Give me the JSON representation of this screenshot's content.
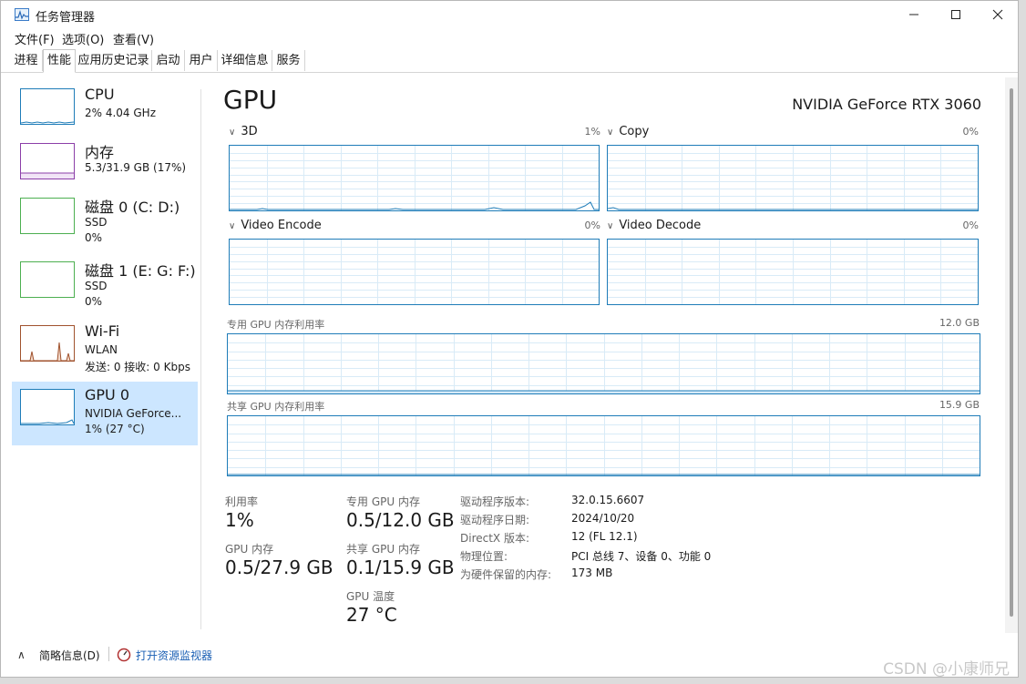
{
  "window": {
    "title": "任务管理器"
  },
  "menu": {
    "items": [
      "文件(F)",
      "选项(O)",
      "查看(V)"
    ]
  },
  "tabs": [
    "进程",
    "性能",
    "应用历史记录",
    "启动",
    "用户",
    "详细信息",
    "服务"
  ],
  "active_tab_index": 1,
  "sidebar": {
    "items": [
      {
        "name": "CPU",
        "line1": "2% 4.04 GHz",
        "line2": "",
        "color": "#1e7cb8"
      },
      {
        "name": "内存",
        "line1": "5.3/31.9 GB (17%)",
        "line2": "",
        "color": "#8b3ea8"
      },
      {
        "name": "磁盘 0 (C: D:)",
        "line1": "SSD",
        "line2": "0%",
        "color": "#4caf50"
      },
      {
        "name": "磁盘 1 (E: G: F:)",
        "line1": "SSD",
        "line2": "0%",
        "color": "#4caf50"
      },
      {
        "name": "Wi-Fi",
        "line1": "WLAN",
        "line2": "发送: 0 接收: 0 Kbps",
        "color": "#a0522d"
      },
      {
        "name": "GPU 0",
        "line1": "NVIDIA GeForce...",
        "line2": "1% (27 °C)",
        "color": "#1e7cb8"
      }
    ],
    "active_index": 5
  },
  "main": {
    "title": "GPU",
    "model": "NVIDIA GeForce RTX 3060",
    "engines": [
      {
        "label": "3D",
        "pct": "1%"
      },
      {
        "label": "Copy",
        "pct": "0%"
      },
      {
        "label": "Video Encode",
        "pct": "0%"
      },
      {
        "label": "Video Decode",
        "pct": "0%"
      }
    ],
    "dedicated_mem_label": "专用 GPU 内存利用率",
    "dedicated_mem_max": "12.0 GB",
    "shared_mem_label": "共享 GPU 内存利用率",
    "shared_mem_max": "15.9 GB"
  },
  "stats": {
    "utilization_label": "利用率",
    "utilization_value": "1%",
    "gpu_mem_label": "GPU 内存",
    "gpu_mem_value": "0.5/27.9 GB",
    "dedicated_label": "专用 GPU 内存",
    "dedicated_value": "0.5/12.0 GB",
    "shared_label": "共享 GPU 内存",
    "shared_value": "0.1/15.9 GB",
    "temp_label": "GPU 温度",
    "temp_value": "27 °C"
  },
  "info": [
    {
      "key": "驱动程序版本:",
      "value": "32.0.15.6607"
    },
    {
      "key": "驱动程序日期:",
      "value": "2024/10/20"
    },
    {
      "key": "DirectX 版本:",
      "value": "12 (FL 12.1)"
    },
    {
      "key": "物理位置:",
      "value": "PCI 总线 7、设备 0、功能 0"
    },
    {
      "key": "为硬件保留的内存:",
      "value": "173 MB"
    }
  ],
  "footer": {
    "less_details": "简略信息(D)",
    "open_monitor": "打开资源监视器"
  },
  "watermark": "CSDN @小康师兄"
}
